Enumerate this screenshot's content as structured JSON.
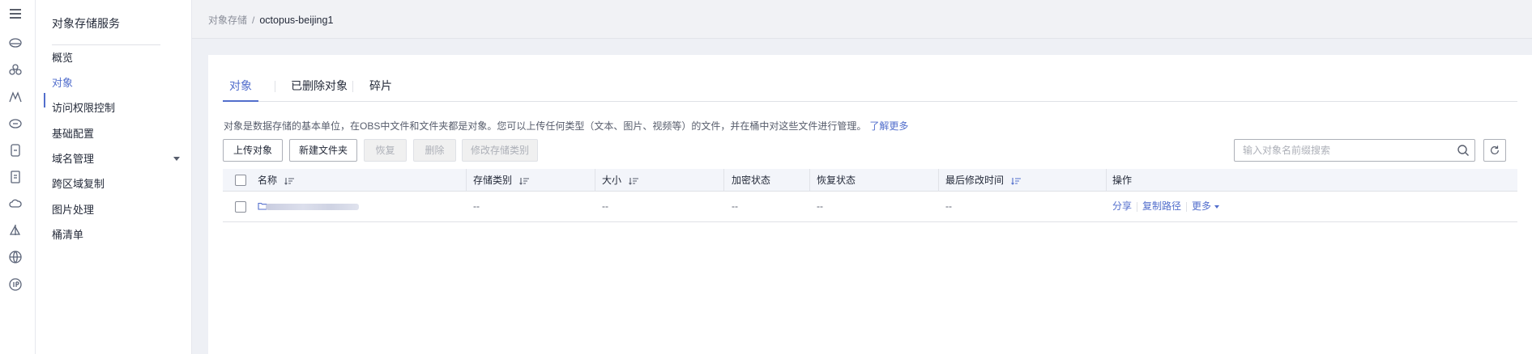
{
  "rail": {
    "icons": [
      "menu-icon",
      "cloud-disk-icon",
      "cloud-group-icon",
      "mountain-icon",
      "cdn-icon",
      "storage-icon",
      "document-icon",
      "cloud-icon",
      "sail-icon",
      "globe-icon",
      "ip-icon"
    ]
  },
  "nav": {
    "title": "对象存储服务",
    "items": [
      {
        "label": "概览"
      },
      {
        "label": "对象"
      },
      {
        "label": "访问权限控制"
      },
      {
        "label": "基础配置"
      },
      {
        "label": "域名管理"
      },
      {
        "label": "跨区域复制"
      },
      {
        "label": "图片处理"
      },
      {
        "label": "桶清单"
      }
    ],
    "active_item": "对象"
  },
  "breadcrumb": {
    "root": "对象存储",
    "separator": "/",
    "current": "octopus-beijing1"
  },
  "tabs": [
    {
      "label": "对象"
    },
    {
      "label": "已删除对象"
    },
    {
      "label": "碎片"
    }
  ],
  "description": {
    "text": "对象是数据存储的基本单位，在OBS中文件和文件夹都是对象。您可以上传任何类型（文本、图片、视频等）的文件，并在桶中对这些文件进行管理。",
    "link": "了解更多"
  },
  "toolbar": {
    "upload": "上传对象",
    "new_folder": "新建文件夹",
    "restore": "恢复",
    "delete": "删除",
    "change_class": "修改存储类别"
  },
  "search": {
    "placeholder": "输入对象名前缀搜索",
    "value": ""
  },
  "table": {
    "headers": {
      "name": "名称",
      "storage_class": "存储类别",
      "size": "大小",
      "encryption": "加密状态",
      "restore": "恢复状态",
      "modified": "最后修改时间",
      "actions": "操作"
    },
    "rows": [
      {
        "name": "",
        "storage_class": "--",
        "size": "--",
        "encryption": "--",
        "restore": "--",
        "modified": "--",
        "actions": {
          "share": "分享",
          "copy_path": "复制路径",
          "more": "更多"
        }
      }
    ]
  },
  "colors": {
    "accent": "#526ecc",
    "text": "#252b3a",
    "muted": "#575d6c",
    "disabled_bg": "#f0f0f0"
  }
}
